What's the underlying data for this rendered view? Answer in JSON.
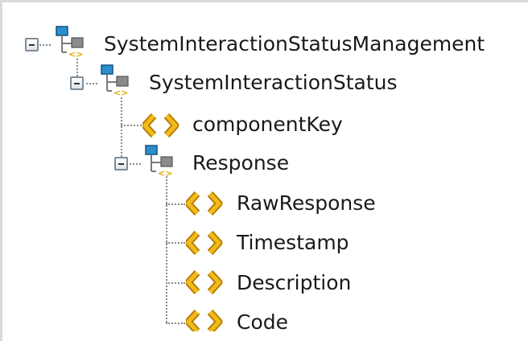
{
  "tree": {
    "root": {
      "label": "SystemInteractionStatusManagement",
      "icon": "complex-type-icon",
      "expanded": true,
      "children": {
        "status": {
          "label": "SystemInteractionStatus",
          "icon": "complex-type-icon",
          "expanded": true,
          "children": {
            "component_key": {
              "label": "componentKey",
              "icon": "element-icon"
            },
            "response": {
              "label": "Response",
              "icon": "complex-type-icon",
              "expanded": true,
              "children": [
                {
                  "label": "RawResponse",
                  "icon": "element-icon"
                },
                {
                  "label": "Timestamp",
                  "icon": "element-icon"
                },
                {
                  "label": "Description",
                  "icon": "element-icon"
                },
                {
                  "label": "Code",
                  "icon": "element-icon"
                }
              ]
            }
          }
        }
      }
    }
  },
  "colors": {
    "element_icon": "#e0a800",
    "complex_node_top": "#2a8fd0",
    "complex_node_bottom": "#7a7a7a",
    "connector": "#8a8a8a"
  }
}
